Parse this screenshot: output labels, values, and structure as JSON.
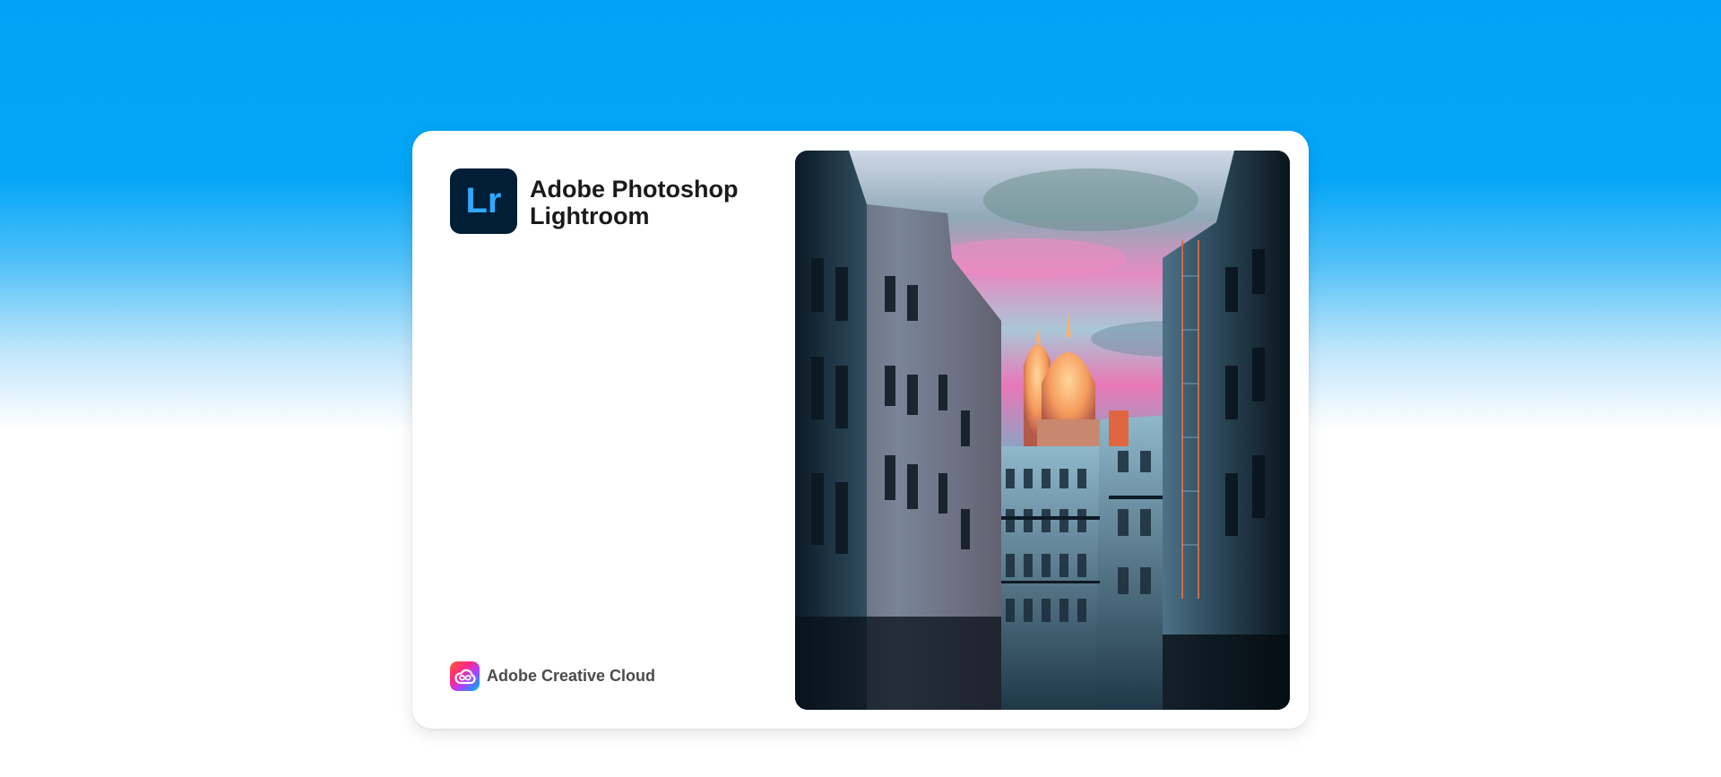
{
  "app": {
    "logo_mark": "Lr",
    "title_line1": "Adobe Photoshop",
    "title_line2": "Lightroom"
  },
  "footer": {
    "brand_label": "Adobe Creative Cloud",
    "brand_icon": "creative-cloud-icon"
  },
  "hero": {
    "subject": "paris-street-sacre-coeur-photo"
  },
  "colors": {
    "background_top": "#00a3f7",
    "background_bottom": "#ffffff",
    "card": "#ffffff",
    "lr_tile": "#001e36",
    "lr_text": "#31a8ff",
    "title_text": "#1a1a1a",
    "footer_text": "#4b4b4b"
  }
}
